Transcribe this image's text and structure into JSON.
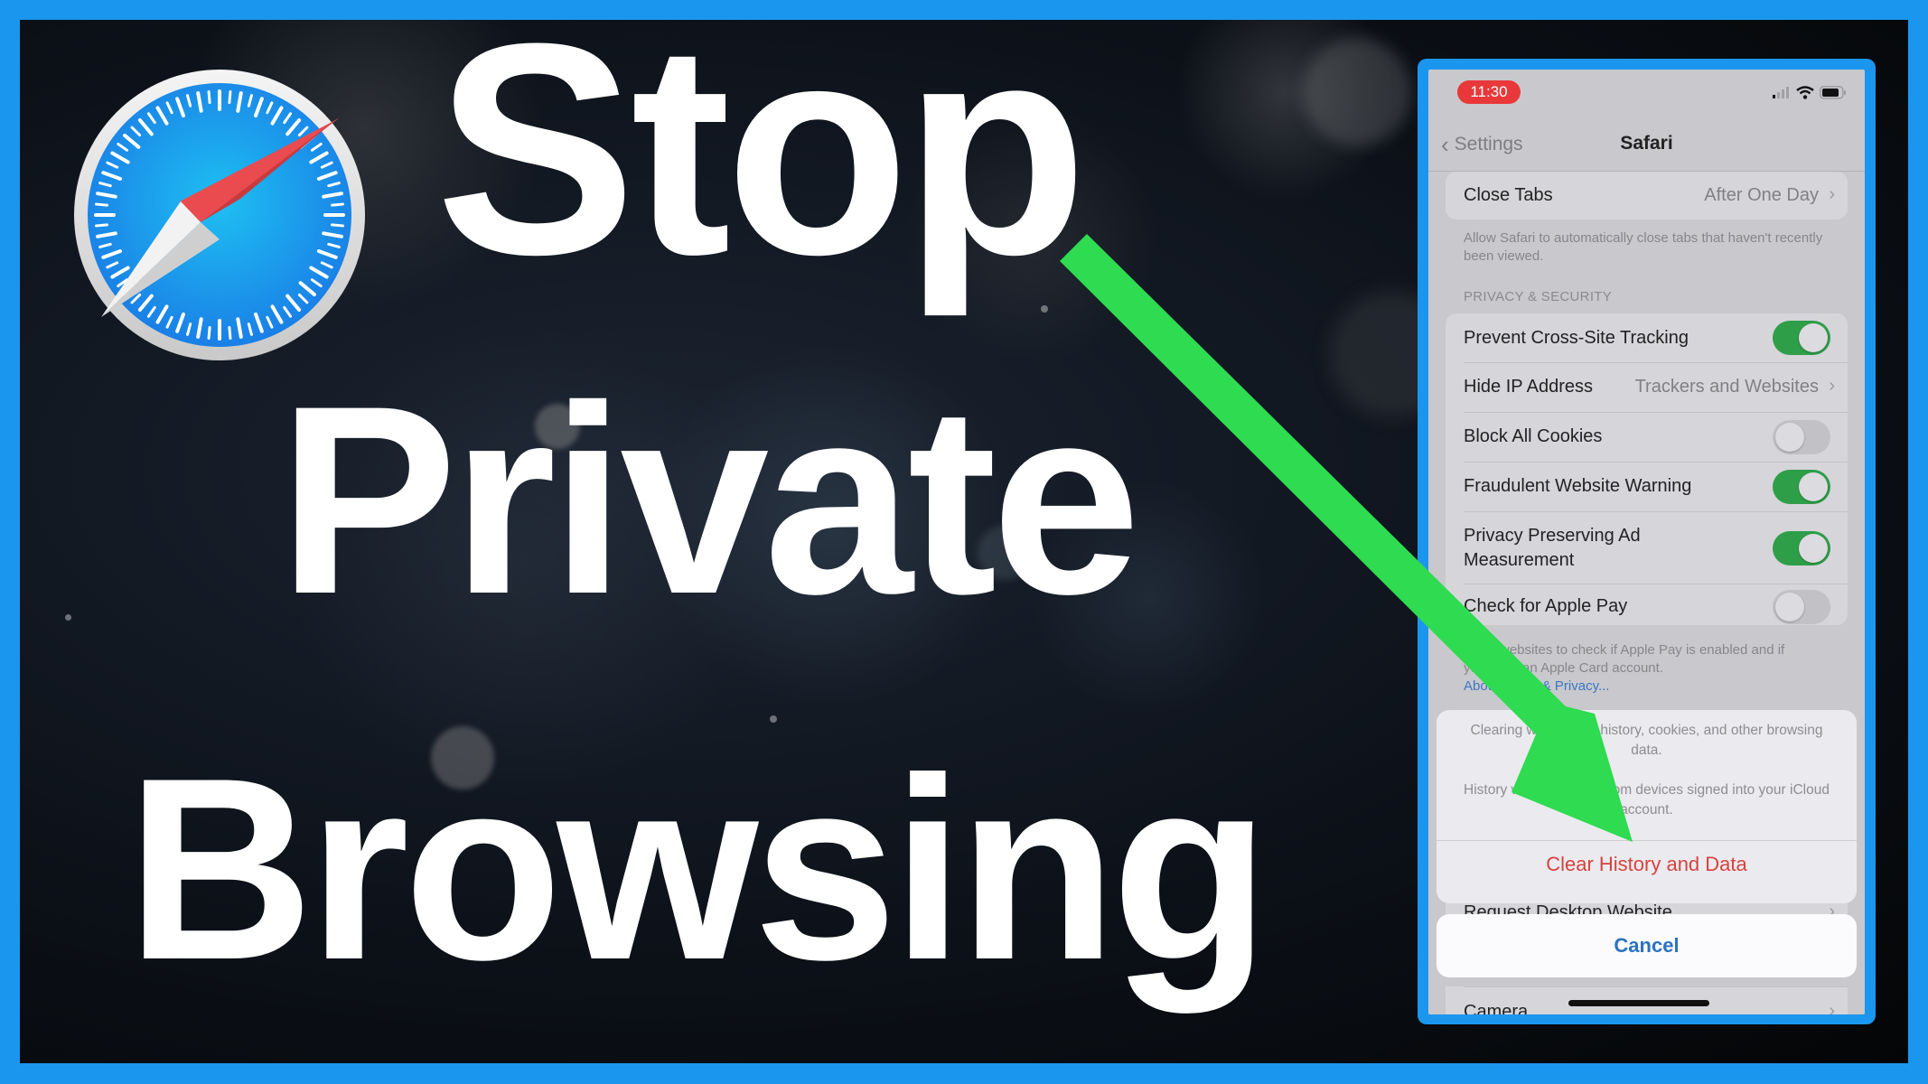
{
  "thumbnail": {
    "headline": [
      "Stop",
      "Private",
      "Browsing"
    ],
    "logo": "safari-compass-icon",
    "accent_frame_color": "#1b96ee",
    "arrow_color": "#2fdb50"
  },
  "phone": {
    "status_bar": {
      "time": "11:30",
      "icons": [
        "cellular-signal-icon",
        "wifi-icon",
        "battery-icon"
      ]
    },
    "nav": {
      "back_label": "Settings",
      "title": "Safari"
    },
    "close_tabs": {
      "label": "Close Tabs",
      "value": "After One Day",
      "footer": "Allow Safari to automatically close tabs that haven't recently been viewed."
    },
    "privacy_section": {
      "header": "PRIVACY & SECURITY",
      "rows": [
        {
          "label": "Prevent Cross-Site Tracking",
          "type": "toggle",
          "on": true
        },
        {
          "label": "Hide IP Address",
          "type": "link",
          "value": "Trackers and Websites"
        },
        {
          "label": "Block All Cookies",
          "type": "toggle",
          "on": false
        },
        {
          "label": "Fraudulent Website Warning",
          "type": "toggle",
          "on": true
        },
        {
          "label": "Privacy Preserving Ad Measurement",
          "type": "toggle",
          "on": true
        },
        {
          "label": "Check for Apple Pay",
          "type": "toggle",
          "on": false
        }
      ],
      "footer_lines": [
        "Allow websites to check if Apple Pay is enabled and if",
        "you have an Apple Card account."
      ],
      "footer_link": "About Safari & Privacy..."
    },
    "action_sheet": {
      "message_1": "Clearing will remove history, cookies, and other browsing data.",
      "message_2": "History will be cleared from devices signed into your iCloud account.",
      "destructive_action": "Clear History and Data",
      "cancel": "Cancel"
    },
    "background_rows": {
      "request_desktop": "Request Desktop Website",
      "camera": "Camera"
    }
  }
}
